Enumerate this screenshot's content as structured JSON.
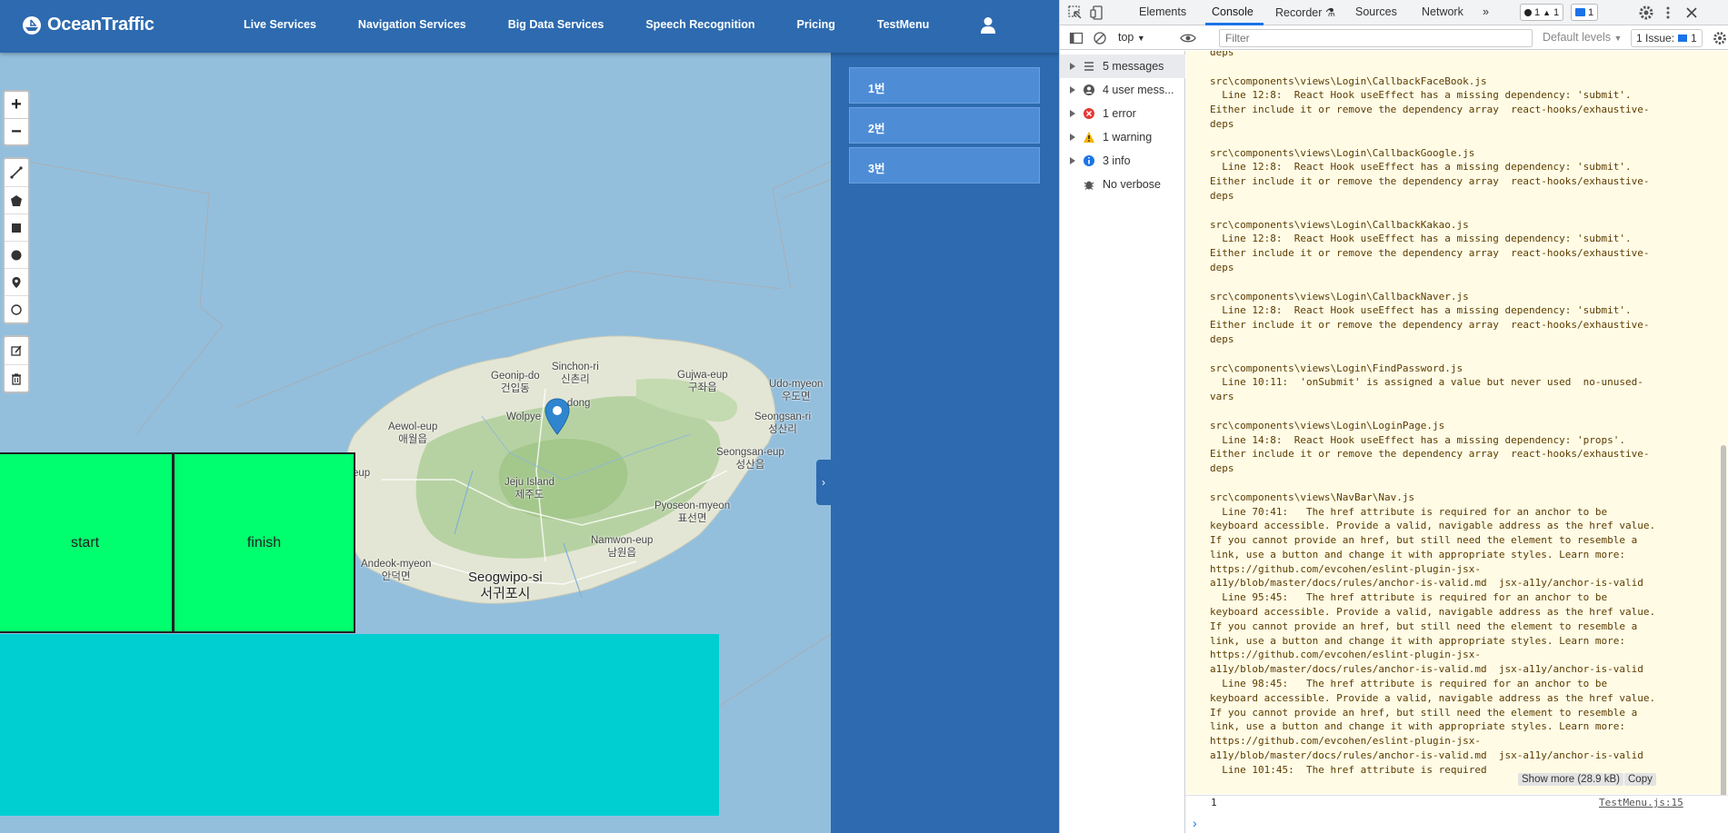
{
  "navbar": {
    "brand": "OceanTraffic",
    "items": [
      "Live Services",
      "Navigation Services",
      "Big Data Services",
      "Speech Recognition",
      "Pricing",
      "TestMenu"
    ]
  },
  "map": {
    "zoom_in": "+",
    "zoom_out": "−",
    "places": [
      {
        "text": "Geonip-do",
        "sub": "건입동"
      },
      {
        "text": "Sinchon-ri",
        "sub": "신촌리"
      },
      {
        "text": "Gujwa-eup",
        "sub": "구좌읍"
      },
      {
        "text": "Udo-myeon",
        "sub": "우도면"
      },
      {
        "text": "Aewol-eup",
        "sub": "애월읍"
      },
      {
        "text": "Wolpye",
        "sub": ""
      },
      {
        "text": "-dong",
        "sub": ""
      },
      {
        "text": "Seongsan-ri",
        "sub": "성산리"
      },
      {
        "text": "Seongsan-eup",
        "sub": "성산읍"
      },
      {
        "text": "Jeju Island",
        "sub": "제주도"
      },
      {
        "text": "Pyoseon-myeon",
        "sub": "표선면"
      },
      {
        "text": "Namwon-eup",
        "sub": "남원읍"
      },
      {
        "text": "Andeok-myeon",
        "sub": "안덕면"
      },
      {
        "text": "Seogwipo-si",
        "sub": "서귀포시"
      },
      {
        "text": "eup",
        "sub": ""
      }
    ]
  },
  "buttons": {
    "start": "start",
    "finish": "finish"
  },
  "side_panel": {
    "items": [
      "1번",
      "2번",
      "3번"
    ],
    "collapse": "›"
  },
  "devtools": {
    "tabs": [
      "Elements",
      "Console",
      "Recorder",
      "Sources",
      "Network"
    ],
    "more": "»",
    "badge_errors": "1",
    "badge_warnings": "1",
    "badge_messages": "1",
    "context": "top",
    "filter_placeholder": "Filter",
    "levels": "Default levels",
    "issues": "1 Issue:",
    "issues_count": "1",
    "sidebar": [
      {
        "label": "5 messages",
        "icon": "list-icon"
      },
      {
        "label": "4 user mess...",
        "icon": "user-icon"
      },
      {
        "label": "1 error",
        "icon": "error-icon"
      },
      {
        "label": "1 warning",
        "icon": "warning-icon"
      },
      {
        "label": "3 info",
        "icon": "info-icon"
      },
      {
        "label": "No verbose",
        "icon": "bug-icon"
      }
    ],
    "console_text": "deps\n\nsrc\\components\\views\\Login\\CallbackFaceBook.js\n  Line 12:8:  React Hook useEffect has a missing dependency: 'submit'.\nEither include it or remove the dependency array  react-hooks/exhaustive-\ndeps\n\nsrc\\components\\views\\Login\\CallbackGoogle.js\n  Line 12:8:  React Hook useEffect has a missing dependency: 'submit'.\nEither include it or remove the dependency array  react-hooks/exhaustive-\ndeps\n\nsrc\\components\\views\\Login\\CallbackKakao.js\n  Line 12:8:  React Hook useEffect has a missing dependency: 'submit'.\nEither include it or remove the dependency array  react-hooks/exhaustive-\ndeps\n\nsrc\\components\\views\\Login\\CallbackNaver.js\n  Line 12:8:  React Hook useEffect has a missing dependency: 'submit'.\nEither include it or remove the dependency array  react-hooks/exhaustive-\ndeps\n\nsrc\\components\\views\\Login\\FindPassword.js\n  Line 10:11:  'onSubmit' is assigned a value but never used  no-unused-\nvars\n\nsrc\\components\\views\\Login\\LoginPage.js\n  Line 14:8:  React Hook useEffect has a missing dependency: 'props'.\nEither include it or remove the dependency array  react-hooks/exhaustive-\ndeps\n\nsrc\\components\\views\\NavBar\\Nav.js\n  Line 70:41:   The href attribute is required for an anchor to be\nkeyboard accessible. Provide a valid, navigable address as the href value.\nIf you cannot provide an href, but still need the element to resemble a\nlink, use a button and change it with appropriate styles. Learn more:\nhttps://github.com/evcohen/eslint-plugin-jsx-\na11y/blob/master/docs/rules/anchor-is-valid.md  jsx-a11y/anchor-is-valid\n  Line 95:45:   The href attribute is required for an anchor to be\nkeyboard accessible. Provide a valid, navigable address as the href value.\nIf you cannot provide an href, but still need the element to resemble a\nlink, use a button and change it with appropriate styles. Learn more:\nhttps://github.com/evcohen/eslint-plugin-jsx-\na11y/blob/master/docs/rules/anchor-is-valid.md  jsx-a11y/anchor-is-valid\n  Line 98:45:   The href attribute is required for an anchor to be\nkeyboard accessible. Provide a valid, navigable address as the href value.\nIf you cannot provide an href, but still need the element to resemble a\nlink, use a button and change it with appropriate styles. Learn more:\nhttps://github.com/evcohen/eslint-plugin-jsx-\na11y/blob/master/docs/rules/anchor-is-valid.md  jsx-a11y/anchor-is-valid\n  Line 101:45:  The href attribute is required",
    "show_more": "Show more (28.9 kB)",
    "copy": "Copy",
    "log_value": "1",
    "log_source": "TestMenu.js:15",
    "prompt": "›"
  },
  "colors": {
    "navbar": "#2d6aaf",
    "sea": "#93bfdd",
    "start_finish": "#00ff6e",
    "panel": "#00cfd2",
    "side_button": "#4e8cd6",
    "console_bg": "#fffbe5"
  }
}
